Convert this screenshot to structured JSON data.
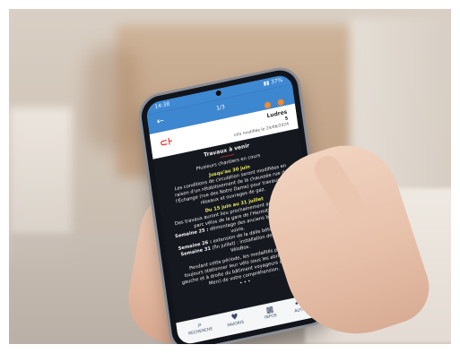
{
  "status_bar": {
    "time": "14:38",
    "right": "▮▮ 37%"
  },
  "app_bar": {
    "back": "←",
    "page_counter": "1/3"
  },
  "message": {
    "sender": "Ludres",
    "code": "5",
    "date": "info modifiée le 24/06/2024",
    "title": "Travaux à venir",
    "separator": "———",
    "line_intro": "Plusieurs chantiers en cours",
    "date1": "Jusqu'au 30 juin",
    "para1": "Les conditions de circulation seront modifiées en raison d'un rétablissement de la chaussée rue de l'Échange (rue des Notre Dame) pour travaux sur réseaux et ouvrages de gaz.",
    "date2": "Du 15 juin au 31 juillet",
    "para2": "Des travaux auront lieu prochainement au niveau du parc vélos de la gare de l'Hermitage.",
    "week25_label": "Semaine 25 :",
    "week25_text": "démontage des anciens box vélos côté voirie.",
    "week26_label": "Semaine 26 :",
    "week26_text": "extension de la dalle béton existante.",
    "week31_label": "Semaine 31",
    "week31_text": "(fin juillet) : installation des nouveaux VéloBox.",
    "para3": "Pendant cette période, les modalités pourront toujours stationner leur vélo sous les abris situés à gauche et à droite du bâtiment voyageurs côté voirie. Merci de votre compréhension.",
    "more": "• • •"
  },
  "tabbar": {
    "items": [
      {
        "icon": "search-icon",
        "glyph": "⌕",
        "label": "RECHERCHE"
      },
      {
        "icon": "heart-icon",
        "glyph": "♥",
        "label": "FAVORIS"
      },
      {
        "icon": "calendar-icon",
        "glyph": "▦",
        "label": "INFOS"
      },
      {
        "icon": "more-icon",
        "glyph": "•••",
        "label": "AUTRES"
      }
    ]
  },
  "colors": {
    "appbar": "#3d86d0",
    "accent_orange": "#f08b2f",
    "highlight_yellow": "#e8e85c",
    "separator_red": "#ff3b30"
  }
}
